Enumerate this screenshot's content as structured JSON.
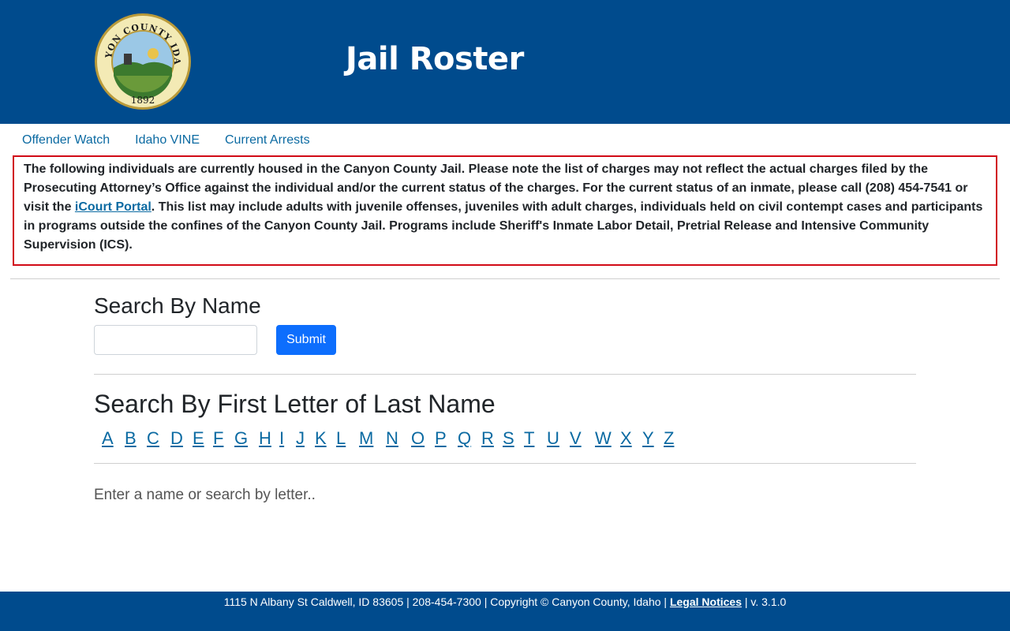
{
  "header": {
    "title": "Jail Roster",
    "logo": {
      "top_text": "CANYON COUNTY IDAHO",
      "year": "1892",
      "icon": "county-seal-icon",
      "colors": {
        "ring": "#f3eab5",
        "gold": "#b99a3a",
        "sky": "#9bc8e6",
        "field": "#3c7a2e"
      }
    }
  },
  "nav": {
    "offender_watch": "Offender Watch",
    "idaho_vine": "Idaho VINE",
    "current_arrests": "Current Arrests"
  },
  "notice": {
    "text_before": "The following individuals are currently housed in the Canyon County Jail. Please note the list of charges may not reflect the actual charges filed by the Prosecuting Attorney’s Office against the individual and/or the current status of the charges. For the current status of an inmate, please call (208) 454-7541 or visit the ",
    "link": "iCourt Portal",
    "text_after": ". This list may include adults with juvenile offenses, juveniles with adult charges, individuals held on civil contempt cases and participants in programs outside the confines of the Canyon County Jail. Programs include Sheriff's Inmate Labor Detail, Pretrial Release and Intensive Community Supervision (ICS).",
    "border_color": "#d10a16"
  },
  "search_name": {
    "heading": "Search By Name",
    "input_value": "",
    "submit_label": "Submit"
  },
  "search_letter": {
    "heading": "Search By First Letter of Last Name",
    "letters": [
      "A",
      "B",
      "C",
      "D",
      "E",
      "F",
      "G",
      "H",
      "I",
      "J",
      "K",
      "L",
      "M",
      "N",
      "O",
      "P",
      "Q",
      "R",
      "S",
      "T",
      "U",
      "V",
      "W",
      "X",
      "Y",
      "Z"
    ]
  },
  "status": "Enter a name or search by letter..",
  "footer": {
    "text": "1115 N Albany St Caldwell, ID 83605 | 208-454-7300 | Copyright © Canyon County, Idaho | ",
    "link": "Legal Notices",
    "version": " | v. 3.1.0"
  },
  "colors": {
    "header_bg": "#004b8d",
    "link": "#0b6aa2",
    "button": "#0d6efd"
  }
}
